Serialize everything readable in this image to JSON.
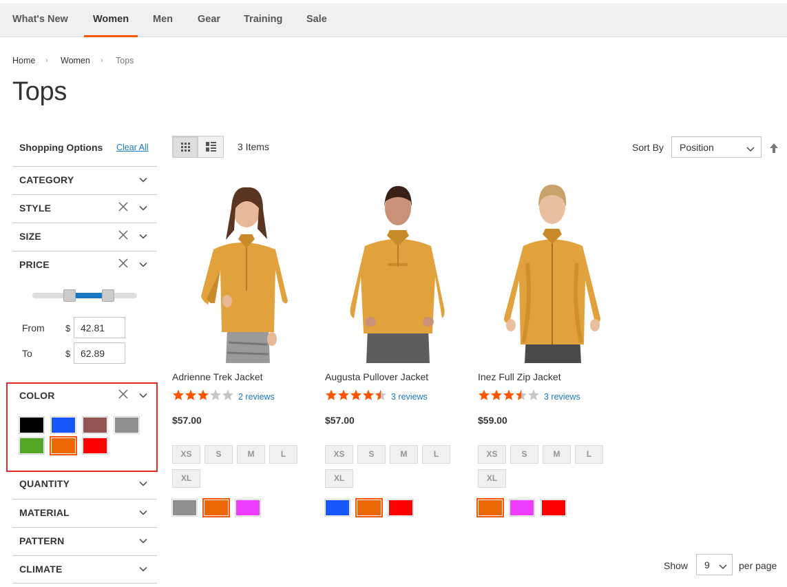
{
  "nav": {
    "items": [
      {
        "label": "What's New"
      },
      {
        "label": "Women"
      },
      {
        "label": "Men"
      },
      {
        "label": "Gear"
      },
      {
        "label": "Training"
      },
      {
        "label": "Sale"
      }
    ],
    "active": "Women",
    "accent": "#ff5501"
  },
  "breadcrumb": {
    "items": [
      "Home",
      "Women",
      "Tops"
    ]
  },
  "page_title": "Tops",
  "sidebar": {
    "title": "Shopping Options",
    "clear_all": "Clear All",
    "filters": [
      {
        "label": "CATEGORY",
        "active": false
      },
      {
        "label": "STYLE",
        "active": true
      },
      {
        "label": "SIZE",
        "active": true
      },
      {
        "label": "PRICE",
        "active": true
      },
      {
        "label": "COLOR",
        "active": true
      },
      {
        "label": "QUANTITY",
        "active": false
      },
      {
        "label": "MATERIAL",
        "active": false
      },
      {
        "label": "PATTERN",
        "active": false
      },
      {
        "label": "CLIMATE",
        "active": false
      }
    ],
    "price": {
      "from_label": "From",
      "to_label": "To",
      "currency": "$",
      "from_value": "42.81",
      "to_value": "62.89"
    },
    "color_swatches": [
      {
        "name": "Black",
        "hex": "#000000"
      },
      {
        "name": "Blue",
        "hex": "#1857f7"
      },
      {
        "name": "Brown",
        "hex": "#945454"
      },
      {
        "name": "Gray",
        "hex": "#8f8f8f"
      },
      {
        "name": "Green",
        "hex": "#53a828"
      },
      {
        "name": "Orange",
        "hex": "#eb6703",
        "selected": true
      },
      {
        "name": "Red",
        "hex": "#ff0000"
      }
    ]
  },
  "toolbar": {
    "items_count": "3 Items",
    "sort_label": "Sort By",
    "sort_value": "Position",
    "view_modes": [
      "grid",
      "list"
    ],
    "active_mode": "grid"
  },
  "products": [
    {
      "name": "Adrienne Trek Jacket",
      "rating": 3,
      "reviews": "2 reviews",
      "price": "$57.00",
      "sizes": [
        "XS",
        "S",
        "M",
        "L",
        "XL"
      ],
      "colors": [
        {
          "name": "Gray",
          "hex": "#8f8f8f"
        },
        {
          "name": "Orange",
          "hex": "#eb6703",
          "selected": true
        },
        {
          "name": "Purple",
          "hex": "#ef3dff"
        }
      ]
    },
    {
      "name": "Augusta Pullover Jacket",
      "rating": 4.5,
      "reviews": "3 reviews",
      "price": "$57.00",
      "sizes": [
        "XS",
        "S",
        "M",
        "L",
        "XL"
      ],
      "colors": [
        {
          "name": "Blue",
          "hex": "#1857f7"
        },
        {
          "name": "Orange",
          "hex": "#eb6703",
          "selected": true
        },
        {
          "name": "Red",
          "hex": "#ff0000"
        }
      ]
    },
    {
      "name": "Inez Full Zip Jacket",
      "rating": 3.5,
      "reviews": "3 reviews",
      "price": "$59.00",
      "sizes": [
        "XS",
        "S",
        "M",
        "L",
        "XL"
      ],
      "colors": [
        {
          "name": "Orange",
          "hex": "#eb6703",
          "selected": true
        },
        {
          "name": "Purple",
          "hex": "#ef3dff"
        },
        {
          "name": "Red",
          "hex": "#ff0000"
        }
      ]
    }
  ],
  "limiter": {
    "show_label": "Show",
    "value": "9",
    "per_page_label": "per page"
  }
}
